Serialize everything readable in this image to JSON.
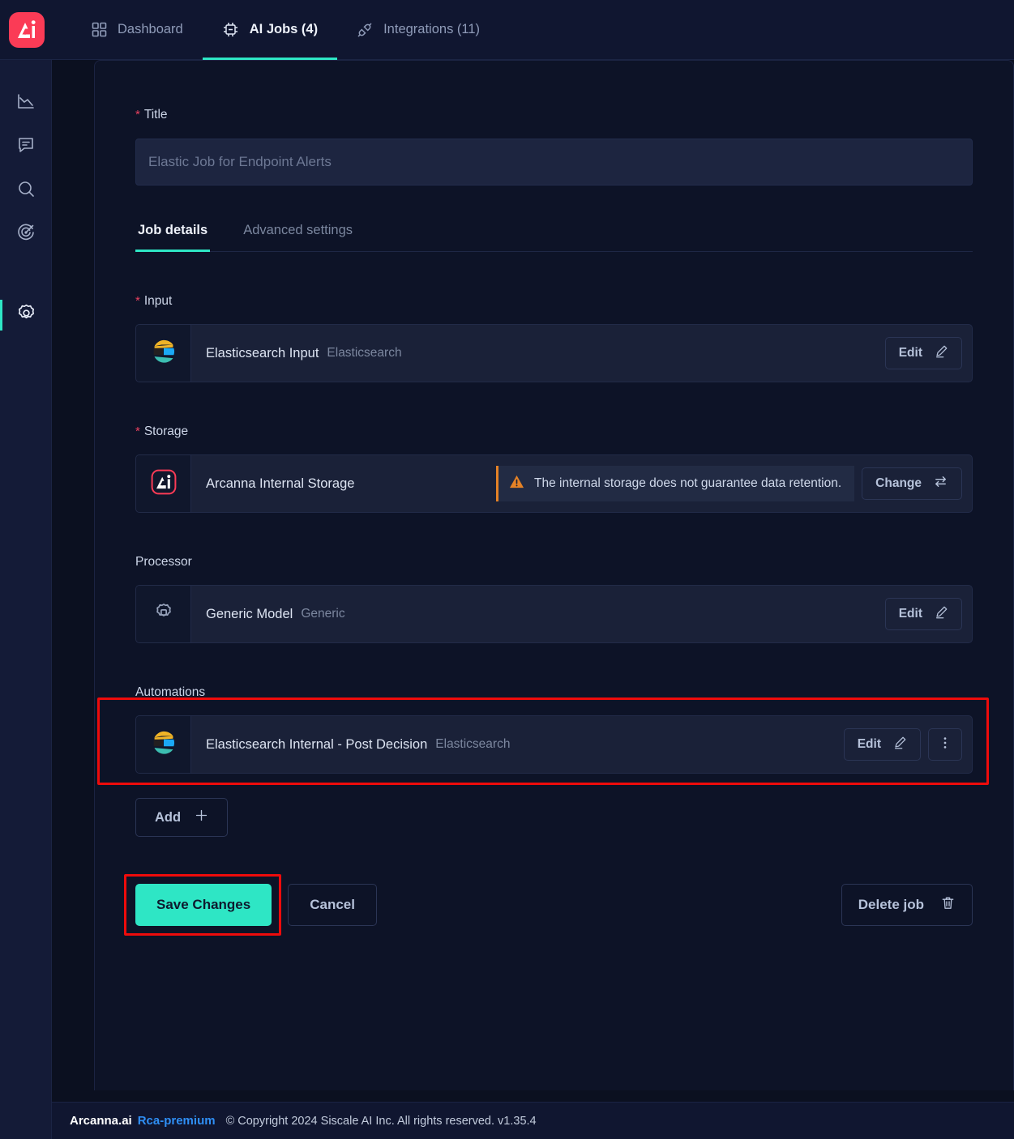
{
  "topbar": {
    "logo_alt": "Arcanna",
    "tabs": [
      {
        "label": "Dashboard",
        "icon": "grid-icon",
        "active": false
      },
      {
        "label": "AI Jobs (4)",
        "icon": "chip-icon",
        "active": true
      },
      {
        "label": "Integrations (11)",
        "icon": "plug-icon",
        "active": false
      }
    ]
  },
  "sidebar": {
    "items": [
      {
        "name": "analytics",
        "icon": "line-chart-icon",
        "active": false
      },
      {
        "name": "feedback",
        "icon": "chat-bubble-icon",
        "active": false
      },
      {
        "name": "search",
        "icon": "search-icon",
        "active": false
      },
      {
        "name": "insights",
        "icon": "target-icon",
        "active": false
      },
      {
        "name": "settings",
        "icon": "gear-icon",
        "active": true
      }
    ]
  },
  "form": {
    "title_label": "Title",
    "title_required": "*",
    "title_value": "",
    "title_placeholder": "Elastic Job for Endpoint Alerts"
  },
  "tabs": {
    "items": [
      {
        "label": "Job details",
        "active": true
      },
      {
        "label": "Advanced settings",
        "active": false
      }
    ]
  },
  "input_section": {
    "label": "Input",
    "required": "*",
    "row": {
      "icon": "elasticsearch-icon",
      "title": "Elasticsearch Input",
      "subtitle": "Elasticsearch",
      "edit_label": "Edit",
      "edit_icon": "pencil-icon"
    }
  },
  "storage_section": {
    "label": "Storage",
    "required": "*",
    "row": {
      "icon": "arcanna-icon",
      "title": "Arcanna Internal Storage",
      "warning_icon": "warning-triangle-icon",
      "warning_text": "The internal storage does not guarantee data retention.",
      "change_label": "Change",
      "change_icon": "swap-arrows-icon"
    }
  },
  "processor_section": {
    "label": "Processor",
    "row": {
      "icon": "processor-chip-icon",
      "title": "Generic Model",
      "subtitle": "Generic",
      "edit_label": "Edit",
      "edit_icon": "pencil-icon"
    }
  },
  "automations_section": {
    "label": "Automations",
    "highlighted": true,
    "row": {
      "icon": "elasticsearch-icon",
      "title": "Elasticsearch Internal - Post Decision",
      "subtitle": "Elasticsearch",
      "edit_label": "Edit",
      "edit_icon": "pencil-icon",
      "more_icon": "more-vertical-icon"
    },
    "add_label": "Add",
    "add_icon": "plus-icon"
  },
  "actions": {
    "save_label": "Save Changes",
    "save_highlighted": true,
    "cancel_label": "Cancel",
    "delete_label": "Delete job",
    "delete_icon": "trash-icon"
  },
  "footer": {
    "brand": "Arcanna.ai",
    "edition": "Rca-premium",
    "copyright": "© Copyright 2024 Siscale AI Inc. All rights reserved. v1.35.4"
  },
  "colors": {
    "accent_teal": "#2ee6c5",
    "brand_pink": "#fb3b56",
    "warning_orange": "#e58226",
    "highlight_red": "#ee0b0b",
    "link_blue": "#2f8ff5"
  }
}
